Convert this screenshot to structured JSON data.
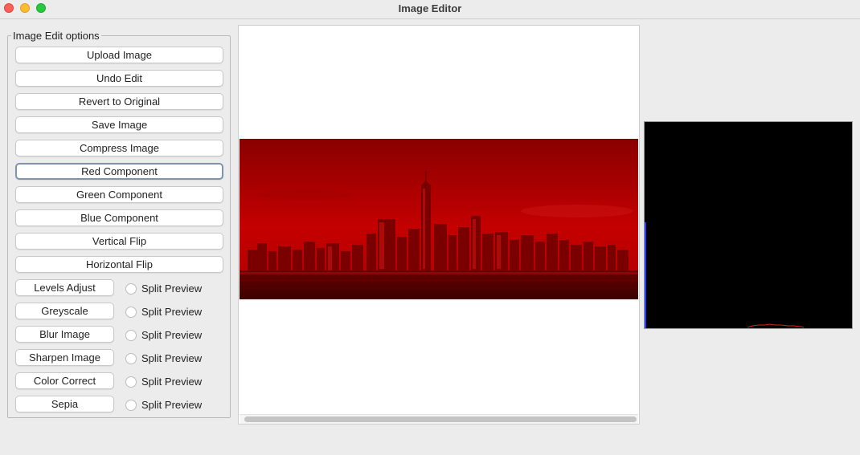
{
  "window": {
    "title": "Image Editor"
  },
  "options_panel": {
    "title": "Image Edit options",
    "buttons": [
      {
        "label": "Upload Image"
      },
      {
        "label": "Undo Edit"
      },
      {
        "label": "Revert to Original"
      },
      {
        "label": "Save Image"
      },
      {
        "label": "Compress Image"
      },
      {
        "label": "Red Component",
        "focused": true
      },
      {
        "label": "Green Component"
      },
      {
        "label": "Blue Component"
      },
      {
        "label": "Vertical Flip"
      },
      {
        "label": "Horizontal Flip"
      }
    ],
    "preview_ops": [
      {
        "label": "Levels Adjust",
        "toggle_label": "Split Preview",
        "checked": false
      },
      {
        "label": "Greyscale",
        "toggle_label": "Split Preview",
        "checked": false
      },
      {
        "label": "Blur Image",
        "toggle_label": "Split Preview",
        "checked": false
      },
      {
        "label": "Sharpen Image",
        "toggle_label": "Split Preview",
        "checked": false
      },
      {
        "label": "Color Correct",
        "toggle_label": "Split Preview",
        "checked": false
      },
      {
        "label": "Sepia",
        "toggle_label": "Split Preview",
        "checked": false
      }
    ]
  },
  "image_view": {
    "tint": "red",
    "subject": "city skyline over water"
  },
  "histogram": {
    "background": "#000000",
    "red_line": "#e02020",
    "blue_line": "#2a3cff"
  },
  "colors": {
    "accent_focus": "#7e94ae"
  }
}
